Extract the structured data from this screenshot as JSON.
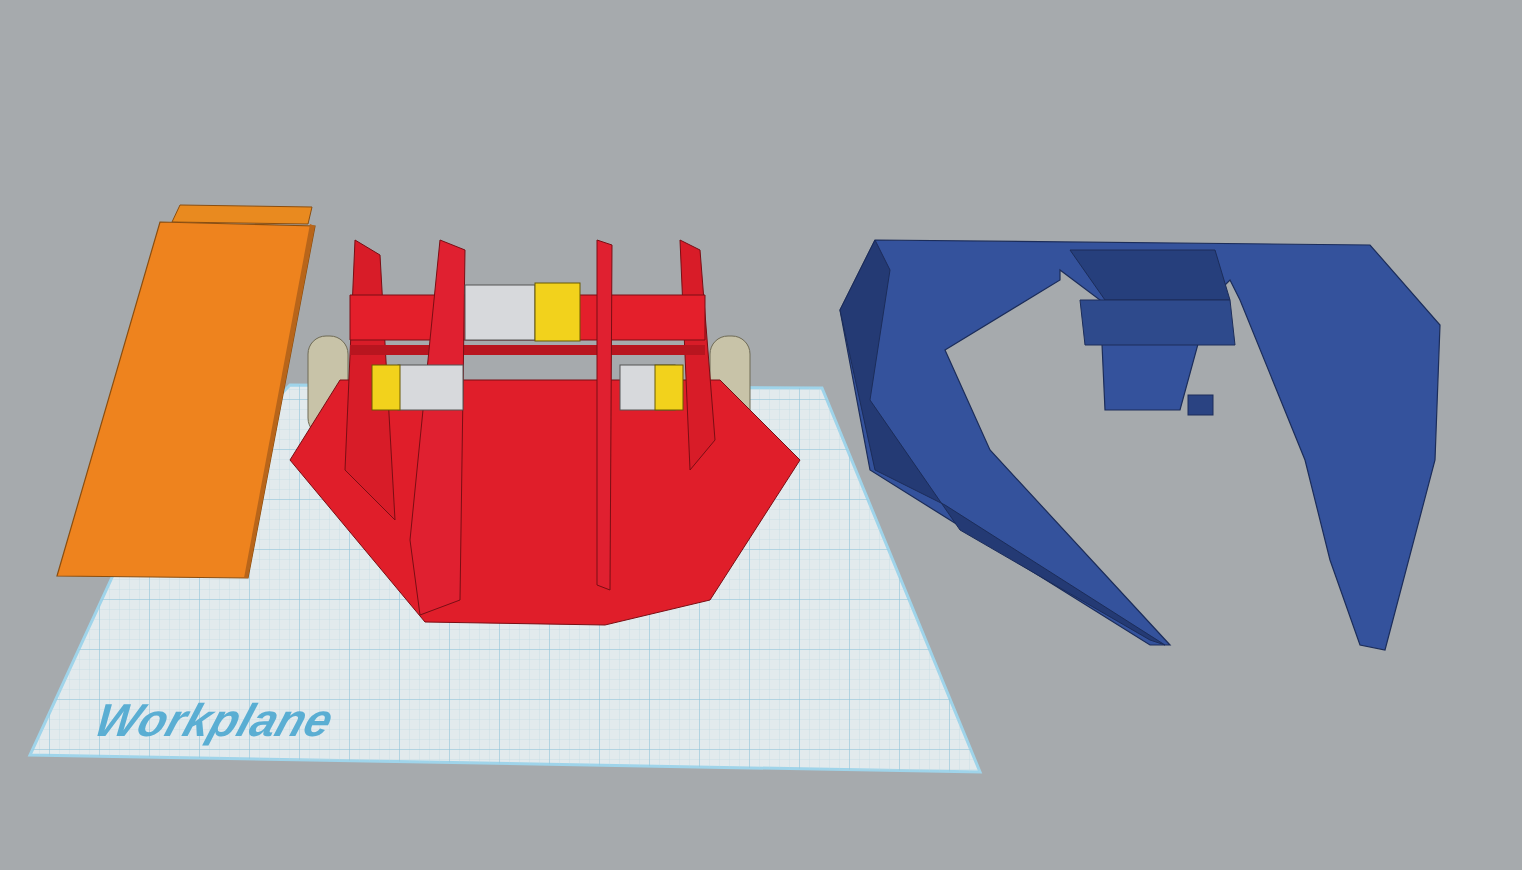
{
  "workplane": {
    "label": "Workplane"
  }
}
